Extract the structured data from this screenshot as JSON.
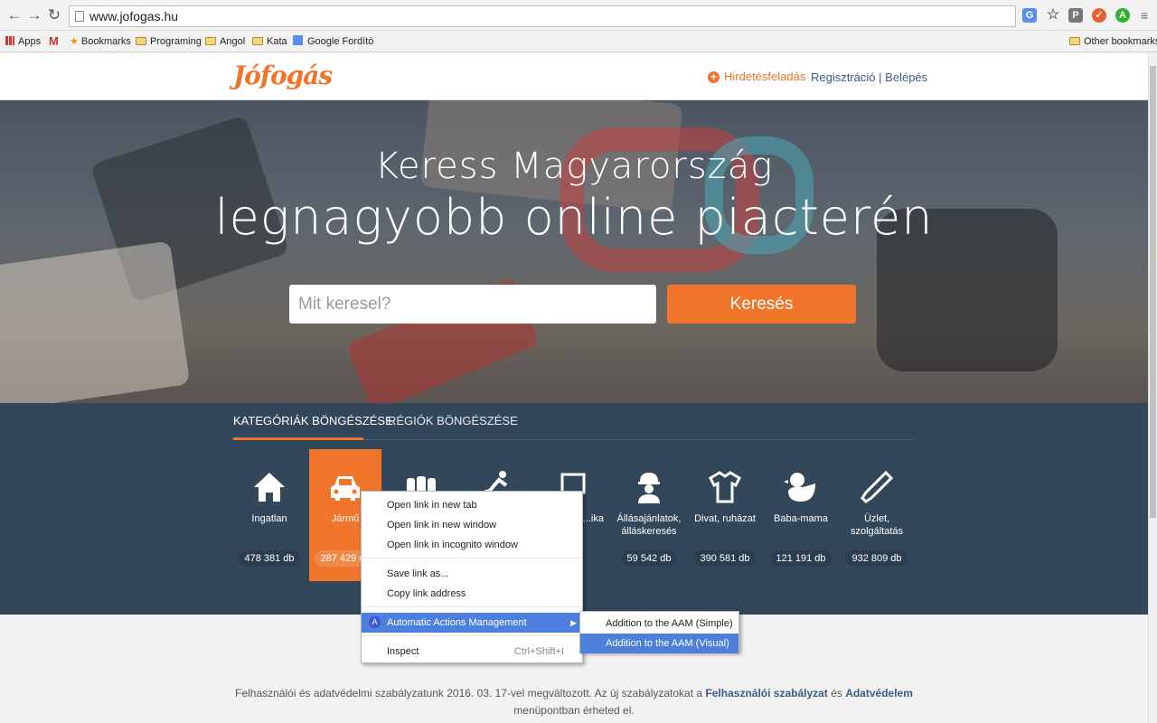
{
  "browser": {
    "url": "www.jofogas.hu",
    "bookmarks": [
      "Apps",
      "Bookmarks",
      "Programing",
      "Angol",
      "Kata",
      "Google Fordító"
    ],
    "other_bookmarks": "Other bookmarks"
  },
  "site": {
    "logo": "Jófogás",
    "post_ad": "Hirdetésfeladás",
    "register": "Regisztráció",
    "login": "Belépés",
    "auth_separator": "|"
  },
  "hero": {
    "line1": "Keress Magyarország",
    "line2": "legnagyobb online piacterén",
    "search_placeholder": "Mit keresel?",
    "search_button": "Keresés"
  },
  "tabs": {
    "categories": "KATEGÓRIÁK BÖNGÉSZÉSE",
    "regions": "RÉGIÓK BÖNGÉSZÉSE"
  },
  "categories": [
    {
      "label": "Ingatlan",
      "count": "478 381 db",
      "icon": "house-icon"
    },
    {
      "label": "Jármű",
      "count": "287 429 db",
      "icon": "car-icon",
      "active": true
    },
    {
      "label": "",
      "count": "",
      "icon": "furniture-icon"
    },
    {
      "label": "",
      "count": "",
      "icon": "sport-icon"
    },
    {
      "label": "...ikkek, ...ika",
      "count": "db",
      "icon": "computer-icon"
    },
    {
      "label": "Állásajánlatok, álláskeresés",
      "count": "59 542 db",
      "icon": "worker-icon"
    },
    {
      "label": "Divat, ruházat",
      "count": "390 581 db",
      "icon": "shirt-icon"
    },
    {
      "label": "Baba-mama",
      "count": "121 191 db",
      "icon": "duck-icon"
    },
    {
      "label": "Üzlet, szolgáltatás",
      "count": "932 809 db",
      "icon": "tool-icon"
    }
  ],
  "footer": {
    "text1": "Felhasználói és adatvédelmi szabályzatunk 2016. 03. 17-vel megváltozott. Az új szabályzatokat a",
    "link1": "Felhasználói szabályzat",
    "and": "és",
    "link2": "Adatvédelem",
    "text2": "menüpontban érheted el."
  },
  "context_menu": {
    "open_new_tab": "Open link in new tab",
    "open_new_window": "Open link in new window",
    "open_incognito": "Open link in incognito window",
    "save_link": "Save link as...",
    "copy_link": "Copy link address",
    "aam": "Automatic Actions Management",
    "inspect": "Inspect",
    "inspect_shortcut": "Ctrl+Shift+I"
  },
  "submenu": {
    "simple": "Addition to the AAM (Simple)",
    "visual": "Addition to the AAM (Visual)"
  },
  "colors": {
    "accent": "#f0742a",
    "navy": "#33475b",
    "menu_highlight": "#4d7fdc"
  }
}
